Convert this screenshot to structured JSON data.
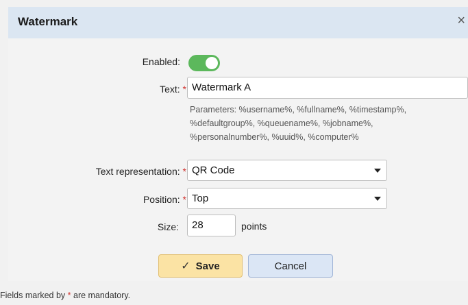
{
  "dialog": {
    "title": "Watermark",
    "close_glyph": "×"
  },
  "form": {
    "enabled_label": "Enabled:",
    "enabled_value": true,
    "text_label": "Text:",
    "text_value": "Watermark A",
    "help_line1": "Parameters: %username%, %fullname%, %timestamp%,",
    "help_line2": "%defaultgroup%, %queuename%, %jobname%,",
    "help_line3": "%personalnumber%, %uuid%, %computer%",
    "representation_label": "Text representation:",
    "representation_value": "QR Code",
    "position_label": "Position:",
    "position_value": "Top",
    "size_label": "Size:",
    "size_value": "28",
    "size_unit": "points",
    "required_mark": "*"
  },
  "buttons": {
    "save_label": "Save",
    "save_icon": "✓",
    "cancel_label": "Cancel"
  },
  "footer": {
    "prefix": "Fields marked by ",
    "mark": "*",
    "suffix": " are mandatory."
  },
  "colors": {
    "toggle_on": "#5cb85c",
    "required": "#d0332f",
    "save_bg": "#fbe3a4",
    "cancel_bg": "#dbe6f5",
    "titlebar_bg": "#dbe6f2"
  }
}
